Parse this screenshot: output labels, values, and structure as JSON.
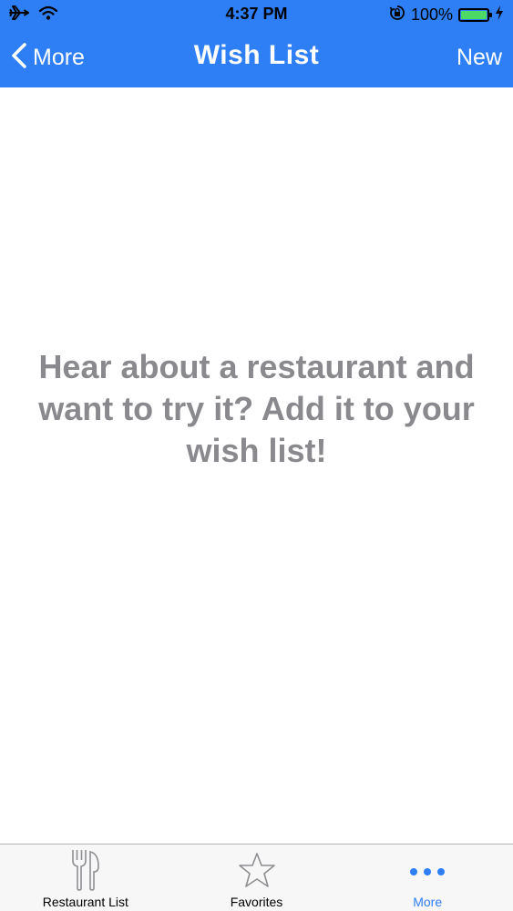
{
  "status_bar": {
    "time": "4:37 PM",
    "battery_percent": "100%",
    "icons": [
      "airplane-icon",
      "wifi-icon",
      "orientation-lock-icon",
      "battery-icon",
      "charging-bolt-icon"
    ]
  },
  "nav": {
    "back_label": "More",
    "title": "Wish List",
    "new_label": "New"
  },
  "content": {
    "empty_message": "Hear about a restaurant and want to try it? Add it to your wish list!"
  },
  "tabs": [
    {
      "label": "Restaurant List",
      "icon": "fork-knife-icon",
      "active": false
    },
    {
      "label": "Favorites",
      "icon": "star-icon",
      "active": false
    },
    {
      "label": "More",
      "icon": "more-dots-icon",
      "active": true
    }
  ],
  "colors": {
    "accent": "#2e7ff6",
    "message_text": "#8a8a8e",
    "battery": "#4cd964",
    "tab_bar_bg": "#f7f7f7"
  }
}
